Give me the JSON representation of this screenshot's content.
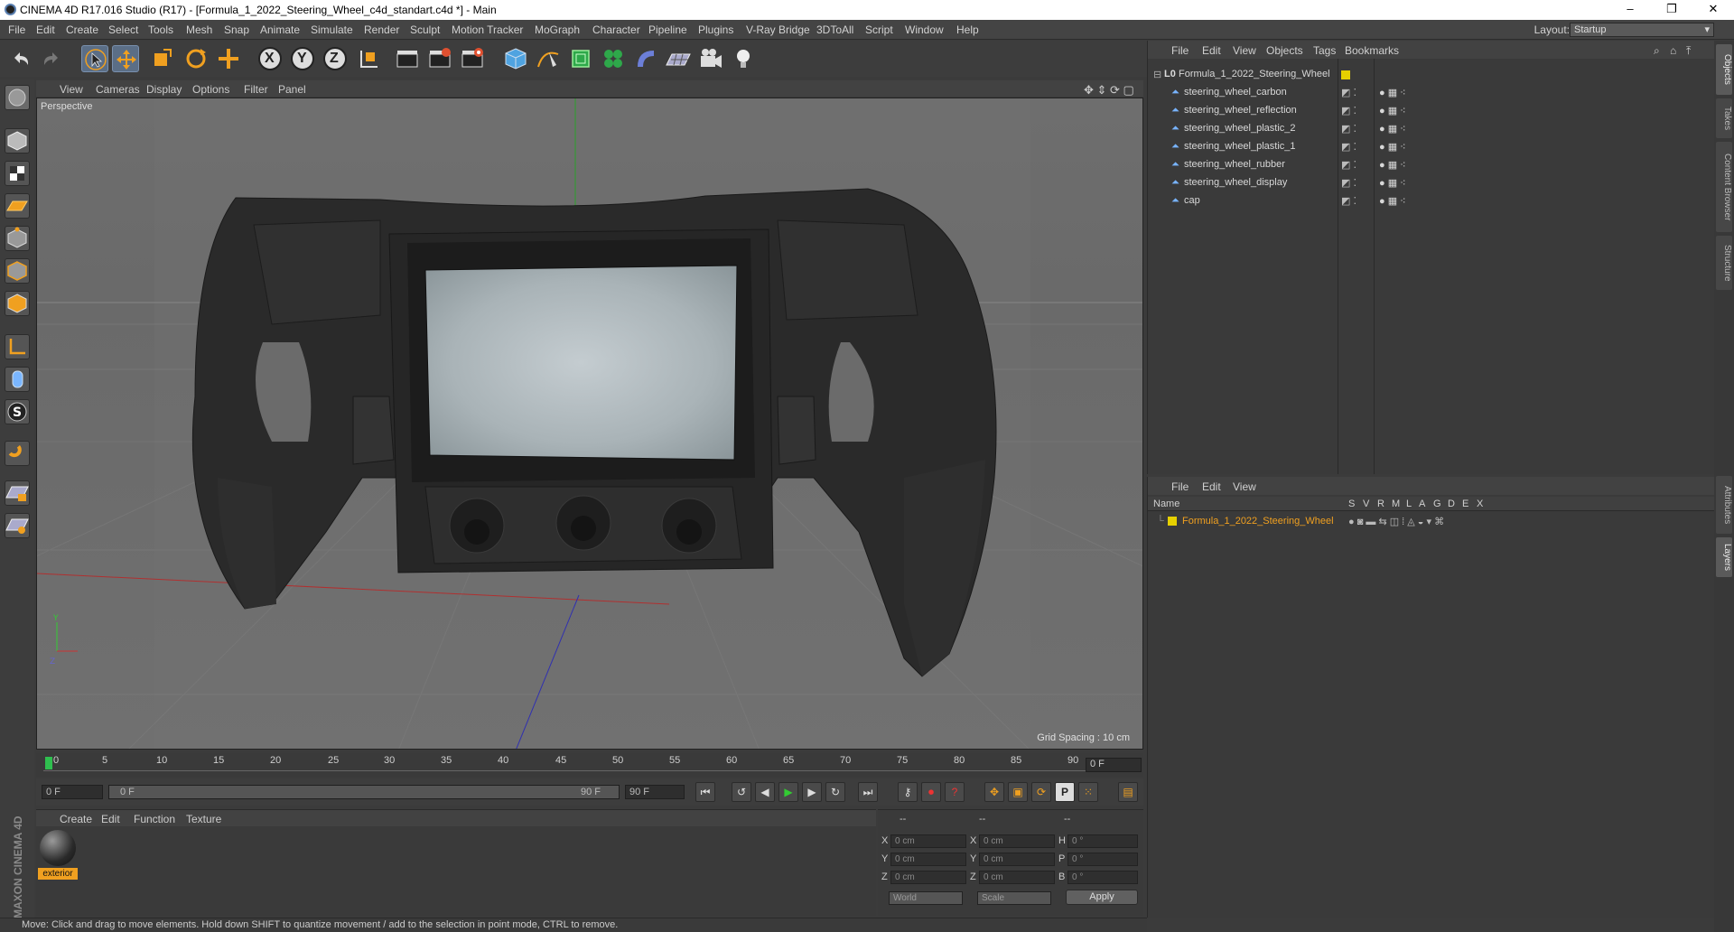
{
  "window": {
    "title": "CINEMA 4D R17.016 Studio (R17) - [Formula_1_2022_Steering_Wheel_c4d_standart.c4d *] - Main",
    "controls": [
      "–",
      "❐",
      "✕"
    ]
  },
  "menubar": {
    "items": [
      "File",
      "Edit",
      "Create",
      "Select",
      "Tools",
      "Mesh",
      "Snap",
      "Animate",
      "Simulate",
      "Render",
      "Sculpt",
      "Motion Tracker",
      "MoGraph",
      "Character",
      "Pipeline",
      "Plugins",
      "V-Ray Bridge",
      "3DToAll",
      "Script",
      "Window",
      "Help"
    ],
    "layout_label": "Layout:",
    "layout_value": "Startup"
  },
  "toolbar": {
    "axis_x": "X",
    "axis_y": "Y",
    "axis_z": "Z"
  },
  "viewport": {
    "menu": [
      "View",
      "Cameras",
      "Display",
      "Options",
      "Filter",
      "Panel"
    ],
    "label": "Perspective",
    "grid_spacing": "Grid Spacing : 10 cm"
  },
  "timeline": {
    "ticks": [
      "0",
      "5",
      "10",
      "15",
      "20",
      "25",
      "30",
      "35",
      "40",
      "45",
      "50",
      "55",
      "60",
      "65",
      "70",
      "75",
      "80",
      "85",
      "90"
    ],
    "current_frame": "0 F"
  },
  "transport": {
    "start_field": "0 F",
    "range_start": "0 F",
    "range_end": "90 F",
    "end_field": "90 F",
    "p_button": "P"
  },
  "materials": {
    "menu": [
      "Create",
      "Edit",
      "Function",
      "Texture"
    ],
    "items": [
      {
        "name": "exterior"
      }
    ]
  },
  "coordinates": {
    "headers": [
      "--",
      "--",
      "--"
    ],
    "rows": [
      {
        "a": "X",
        "v1": "0 cm",
        "b": "X",
        "v2": "0 cm",
        "c": "H",
        "v3": "0 °"
      },
      {
        "a": "Y",
        "v1": "0 cm",
        "b": "Y",
        "v2": "0 cm",
        "c": "P",
        "v3": "0 °"
      },
      {
        "a": "Z",
        "v1": "0 cm",
        "b": "Z",
        "v2": "0 cm",
        "c": "B",
        "v3": "0 °"
      }
    ],
    "mode1": "World",
    "mode2": "Scale",
    "apply": "Apply"
  },
  "status": {
    "text": "Move: Click and drag to move elements. Hold down SHIFT to quantize movement / add to the selection in point mode, CTRL to remove."
  },
  "objects_panel": {
    "menu": [
      "File",
      "Edit",
      "View",
      "Objects",
      "Tags",
      "Bookmarks"
    ],
    "root": "Formula_1_2022_Steering_Wheel",
    "children": [
      "steering_wheel_carbon",
      "steering_wheel_reflection",
      "steering_wheel_plastic_2",
      "steering_wheel_plastic_1",
      "steering_wheel_rubber",
      "steering_wheel_display",
      "cap"
    ]
  },
  "layers_panel": {
    "menu": [
      "File",
      "Edit",
      "View"
    ],
    "name_header": "Name",
    "columns": [
      "S",
      "V",
      "R",
      "M",
      "L",
      "A",
      "G",
      "D",
      "E",
      "X"
    ],
    "layer_name": "Formula_1_2022_Steering_Wheel"
  },
  "right_tabs": [
    "Objects",
    "Takes",
    "Content Browser",
    "Structure",
    "Attributes",
    "Layers"
  ],
  "brand": "MAXON CINEMA 4D",
  "colors": {
    "accent_orange": "#f0a020",
    "selected_blue": "#5b6e86",
    "layer_yellow": "#e6d000",
    "object_icon": "#78b4ff"
  }
}
